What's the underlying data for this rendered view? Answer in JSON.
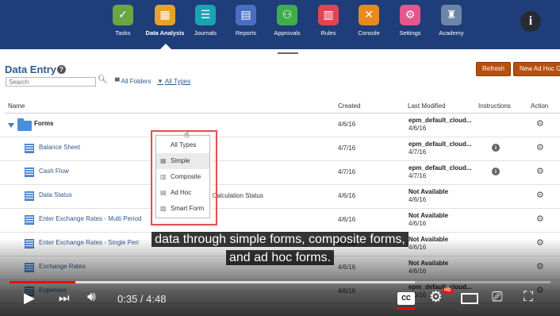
{
  "nav": {
    "items": [
      {
        "label": "Tasks",
        "icon": "tasks-icon",
        "color": "#6ca644",
        "glyph": "✓"
      },
      {
        "label": "Data Analysis",
        "icon": "data-analysis-icon",
        "color": "#e4a22c",
        "glyph": "▦"
      },
      {
        "label": "Journals",
        "icon": "journals-icon",
        "color": "#19a4b3",
        "glyph": "☰"
      },
      {
        "label": "Reports",
        "icon": "reports-icon",
        "color": "#4a6fbf",
        "glyph": "▤"
      },
      {
        "label": "Approvals",
        "icon": "approvals-icon",
        "color": "#3fae4a",
        "glyph": "⚇"
      },
      {
        "label": "Rules",
        "icon": "rules-icon",
        "color": "#df4553",
        "glyph": "▥"
      },
      {
        "label": "Console",
        "icon": "console-icon",
        "color": "#e98a1f",
        "glyph": "✕"
      },
      {
        "label": "Settings",
        "icon": "settings-icon",
        "color": "#e4578e",
        "glyph": "⚙"
      },
      {
        "label": "Academy",
        "icon": "academy-icon",
        "color": "#6d86a8",
        "glyph": "♜"
      }
    ],
    "active": "Data Analysis"
  },
  "info_button": "i",
  "page": {
    "title": "Data Entry",
    "search_placeholder": "Search",
    "filter_folders": "All Folders",
    "filter_types": "All Types",
    "refresh_label": "Refresh",
    "new_adhoc_label": "New Ad Hoc Gr"
  },
  "table": {
    "columns": {
      "name": "Name",
      "created": "Created",
      "modified": "Last Modified",
      "instructions": "Instructions",
      "action": "Action"
    },
    "rows": [
      {
        "name": "Forms",
        "type": "folder",
        "desc": "",
        "created": "4/6/16",
        "mod_user": "epm_default_cloud...",
        "mod_date": "4/6/16",
        "instr": false
      },
      {
        "name": "Balance Sheet",
        "type": "form",
        "desc": "",
        "created": "4/7/16",
        "mod_user": "epm_default_cloud...",
        "mod_date": "4/7/16",
        "instr": true
      },
      {
        "name": "Cash Flow",
        "type": "form",
        "desc": "",
        "created": "4/7/16",
        "mod_user": "epm_default_cloud...",
        "mod_date": "4/7/16",
        "instr": true
      },
      {
        "name": "Data Status",
        "type": "form",
        "desc": "Approval and Calculation Status",
        "created": "4/6/16",
        "mod_user": "Not Available",
        "mod_date": "4/6/16",
        "instr": false
      },
      {
        "name": "Enter Exchange Rates - Multi Period",
        "type": "form",
        "desc": "",
        "created": "4/6/16",
        "mod_user": "Not Available",
        "mod_date": "4/6/16",
        "instr": false
      },
      {
        "name": "Enter Exchange Rates - Single Peri",
        "type": "form",
        "desc": "",
        "created": "4/6/16",
        "mod_user": "Not Available",
        "mod_date": "4/6/16",
        "instr": false
      },
      {
        "name": "Exchange Rates",
        "type": "form",
        "desc": "",
        "created": "4/6/16",
        "mod_user": "Not Available",
        "mod_date": "4/6/16",
        "instr": false
      },
      {
        "name": "Expenses",
        "type": "form",
        "desc": "",
        "created": "4/6/16",
        "mod_user": "epm_default_cloud...",
        "mod_date": "4/6/16",
        "instr": false
      }
    ]
  },
  "dropdown": {
    "items": [
      {
        "label": "All Types",
        "icon": ""
      },
      {
        "label": "Simple",
        "icon": "simple-form-icon"
      },
      {
        "label": "Composite",
        "icon": "composite-form-icon"
      },
      {
        "label": "Ad Hoc",
        "icon": "adhoc-form-icon"
      },
      {
        "label": "Smart Form",
        "icon": "smart-form-icon"
      }
    ],
    "selected": "Simple"
  },
  "caption": {
    "line1": "data through simple forms, composite forms,",
    "line2": "and ad hoc forms."
  },
  "player": {
    "time": "0:35 / 4:48",
    "played_fraction": 0.1215,
    "buffered_fraction": 0.75,
    "cc_label": "CC",
    "hd_label": "HD"
  },
  "colors": {
    "nav_bg": "#1f3d78",
    "accent_orange": "#b5500f",
    "link_blue": "#2d5b8c",
    "progress_red": "#ff0000"
  }
}
